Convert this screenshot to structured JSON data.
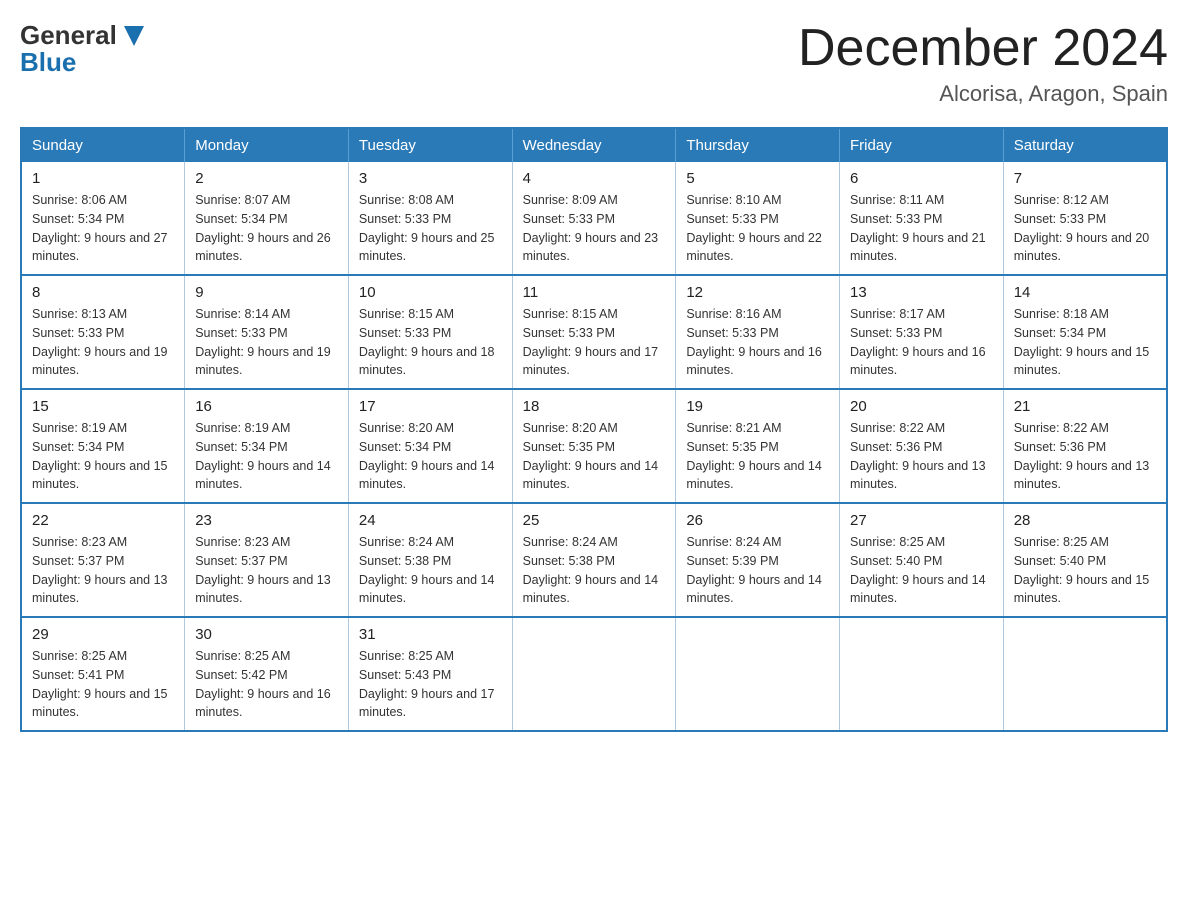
{
  "header": {
    "logo_general": "General",
    "logo_blue": "Blue",
    "month_title": "December 2024",
    "location": "Alcorisa, Aragon, Spain"
  },
  "days_of_week": [
    "Sunday",
    "Monday",
    "Tuesday",
    "Wednesday",
    "Thursday",
    "Friday",
    "Saturday"
  ],
  "weeks": [
    [
      {
        "day": "1",
        "sunrise": "8:06 AM",
        "sunset": "5:34 PM",
        "daylight": "9 hours and 27 minutes."
      },
      {
        "day": "2",
        "sunrise": "8:07 AM",
        "sunset": "5:34 PM",
        "daylight": "9 hours and 26 minutes."
      },
      {
        "day": "3",
        "sunrise": "8:08 AM",
        "sunset": "5:33 PM",
        "daylight": "9 hours and 25 minutes."
      },
      {
        "day": "4",
        "sunrise": "8:09 AM",
        "sunset": "5:33 PM",
        "daylight": "9 hours and 23 minutes."
      },
      {
        "day": "5",
        "sunrise": "8:10 AM",
        "sunset": "5:33 PM",
        "daylight": "9 hours and 22 minutes."
      },
      {
        "day": "6",
        "sunrise": "8:11 AM",
        "sunset": "5:33 PM",
        "daylight": "9 hours and 21 minutes."
      },
      {
        "day": "7",
        "sunrise": "8:12 AM",
        "sunset": "5:33 PM",
        "daylight": "9 hours and 20 minutes."
      }
    ],
    [
      {
        "day": "8",
        "sunrise": "8:13 AM",
        "sunset": "5:33 PM",
        "daylight": "9 hours and 19 minutes."
      },
      {
        "day": "9",
        "sunrise": "8:14 AM",
        "sunset": "5:33 PM",
        "daylight": "9 hours and 19 minutes."
      },
      {
        "day": "10",
        "sunrise": "8:15 AM",
        "sunset": "5:33 PM",
        "daylight": "9 hours and 18 minutes."
      },
      {
        "day": "11",
        "sunrise": "8:15 AM",
        "sunset": "5:33 PM",
        "daylight": "9 hours and 17 minutes."
      },
      {
        "day": "12",
        "sunrise": "8:16 AM",
        "sunset": "5:33 PM",
        "daylight": "9 hours and 16 minutes."
      },
      {
        "day": "13",
        "sunrise": "8:17 AM",
        "sunset": "5:33 PM",
        "daylight": "9 hours and 16 minutes."
      },
      {
        "day": "14",
        "sunrise": "8:18 AM",
        "sunset": "5:34 PM",
        "daylight": "9 hours and 15 minutes."
      }
    ],
    [
      {
        "day": "15",
        "sunrise": "8:19 AM",
        "sunset": "5:34 PM",
        "daylight": "9 hours and 15 minutes."
      },
      {
        "day": "16",
        "sunrise": "8:19 AM",
        "sunset": "5:34 PM",
        "daylight": "9 hours and 14 minutes."
      },
      {
        "day": "17",
        "sunrise": "8:20 AM",
        "sunset": "5:34 PM",
        "daylight": "9 hours and 14 minutes."
      },
      {
        "day": "18",
        "sunrise": "8:20 AM",
        "sunset": "5:35 PM",
        "daylight": "9 hours and 14 minutes."
      },
      {
        "day": "19",
        "sunrise": "8:21 AM",
        "sunset": "5:35 PM",
        "daylight": "9 hours and 14 minutes."
      },
      {
        "day": "20",
        "sunrise": "8:22 AM",
        "sunset": "5:36 PM",
        "daylight": "9 hours and 13 minutes."
      },
      {
        "day": "21",
        "sunrise": "8:22 AM",
        "sunset": "5:36 PM",
        "daylight": "9 hours and 13 minutes."
      }
    ],
    [
      {
        "day": "22",
        "sunrise": "8:23 AM",
        "sunset": "5:37 PM",
        "daylight": "9 hours and 13 minutes."
      },
      {
        "day": "23",
        "sunrise": "8:23 AM",
        "sunset": "5:37 PM",
        "daylight": "9 hours and 13 minutes."
      },
      {
        "day": "24",
        "sunrise": "8:24 AM",
        "sunset": "5:38 PM",
        "daylight": "9 hours and 14 minutes."
      },
      {
        "day": "25",
        "sunrise": "8:24 AM",
        "sunset": "5:38 PM",
        "daylight": "9 hours and 14 minutes."
      },
      {
        "day": "26",
        "sunrise": "8:24 AM",
        "sunset": "5:39 PM",
        "daylight": "9 hours and 14 minutes."
      },
      {
        "day": "27",
        "sunrise": "8:25 AM",
        "sunset": "5:40 PM",
        "daylight": "9 hours and 14 minutes."
      },
      {
        "day": "28",
        "sunrise": "8:25 AM",
        "sunset": "5:40 PM",
        "daylight": "9 hours and 15 minutes."
      }
    ],
    [
      {
        "day": "29",
        "sunrise": "8:25 AM",
        "sunset": "5:41 PM",
        "daylight": "9 hours and 15 minutes."
      },
      {
        "day": "30",
        "sunrise": "8:25 AM",
        "sunset": "5:42 PM",
        "daylight": "9 hours and 16 minutes."
      },
      {
        "day": "31",
        "sunrise": "8:25 AM",
        "sunset": "5:43 PM",
        "daylight": "9 hours and 17 minutes."
      },
      null,
      null,
      null,
      null
    ]
  ],
  "labels": {
    "sunrise_prefix": "Sunrise: ",
    "sunset_prefix": "Sunset: ",
    "daylight_prefix": "Daylight: "
  },
  "colors": {
    "header_bg": "#2a7ab8",
    "border": "#2a7ab8",
    "logo_blue": "#1a6faf"
  }
}
